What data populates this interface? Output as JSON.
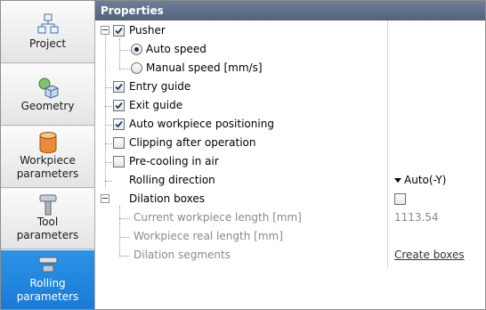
{
  "nav": {
    "items": [
      {
        "label_line1": "Project",
        "label_line2": "",
        "icon": "project-tree-icon"
      },
      {
        "label_line1": "Geometry",
        "label_line2": "",
        "icon": "geometry-cube-icon"
      },
      {
        "label_line1": "Workpiece",
        "label_line2": "parameters",
        "icon": "workpiece-cylinder-icon"
      },
      {
        "label_line1": "Tool",
        "label_line2": "parameters",
        "icon": "tool-hammer-icon"
      },
      {
        "label_line1": "Rolling",
        "label_line2": "parameters",
        "icon": "rolling-anvil-icon"
      }
    ],
    "active_index": 4,
    "active_color": "#1f86dd"
  },
  "panel": {
    "title": "Properties",
    "header_color": "#5f6f88"
  },
  "properties": {
    "pusher": {
      "label": "Pusher",
      "checked": true,
      "expanded": true
    },
    "auto_speed": {
      "label": "Auto speed",
      "selected": true
    },
    "manual_speed": {
      "label": "Manual speed [mm/s]",
      "selected": false
    },
    "entry_guide": {
      "label": "Entry guide",
      "checked": true
    },
    "exit_guide": {
      "label": "Exit guide",
      "checked": true
    },
    "auto_positioning": {
      "label": "Auto workpiece positioning",
      "checked": true
    },
    "clipping": {
      "label": "Clipping after operation",
      "checked": false
    },
    "precooling": {
      "label": "Pre-cooling in air",
      "checked": false
    },
    "rolling_direction": {
      "label": "Rolling direction",
      "value": "Auto(-Y)"
    },
    "dilation_boxes": {
      "label": "Dilation boxes",
      "checked": false,
      "expanded": true
    },
    "current_length": {
      "label": "Current workpiece length [mm]",
      "value": "1113.54"
    },
    "real_length": {
      "label": "Workpiece real length [mm]",
      "value": ""
    },
    "dilation_segments": {
      "label": "Dilation segments",
      "link": "Create boxes"
    }
  }
}
